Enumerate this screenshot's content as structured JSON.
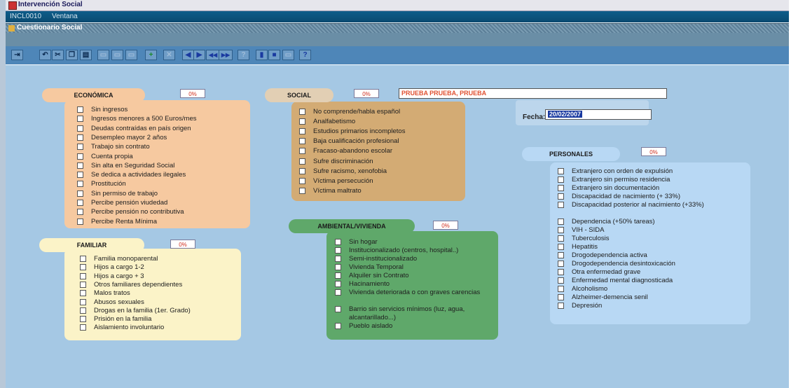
{
  "window": {
    "title": "Intervención Social",
    "menu": [
      "INCL0010",
      "Ventana"
    ],
    "form_title": "Cuestionario Social"
  },
  "toolbar": {
    "buttons": [
      {
        "icon": "exit-icon",
        "glyph": "⇥"
      },
      {
        "icon": "undo-icon",
        "glyph": "↶"
      },
      {
        "icon": "cut-icon",
        "glyph": "✂"
      },
      {
        "icon": "copy-icon",
        "glyph": "❐"
      },
      {
        "icon": "paste-icon",
        "glyph": "▤"
      },
      {
        "icon": "disabled-icon",
        "glyph": "▭"
      },
      {
        "icon": "disabled-icon",
        "glyph": "▭"
      },
      {
        "icon": "disabled-icon",
        "glyph": "▭"
      },
      {
        "icon": "insert-record-icon",
        "glyph": "+"
      },
      {
        "icon": "delete-record-icon",
        "glyph": "✕"
      },
      {
        "icon": "prev-record-icon",
        "glyph": "◀"
      },
      {
        "icon": "next-record-icon",
        "glyph": "▶"
      },
      {
        "icon": "prev-block-icon",
        "glyph": "◀◀"
      },
      {
        "icon": "next-block-icon",
        "glyph": "▶▶"
      },
      {
        "icon": "query-icon",
        "glyph": "?"
      },
      {
        "icon": "book-icon",
        "glyph": "▮"
      },
      {
        "icon": "save-icon",
        "glyph": "■"
      },
      {
        "icon": "print-icon",
        "glyph": "▭"
      },
      {
        "icon": "help-icon",
        "glyph": "?"
      }
    ]
  },
  "person_name": "PRUEBA PRUEBA, PRUEBA",
  "fecha": {
    "label": "Fecha:",
    "value": "20/02/2007"
  },
  "sections": {
    "economica": {
      "title": "ECONÓMICA",
      "percent": "0%",
      "items": [
        "Sin ingresos",
        "Ingresos menores a 500 Euros/mes",
        "Deudas contraídas en país origen",
        "Desempleo mayor 2 años",
        "Trabajo sin contrato",
        "Cuenta propia",
        "Sin alta en Seguridad Social",
        "Se dedica a actividades ilegales",
        "Prostitución",
        "Sin permiso de trabajo",
        "Percibe pensión viudedad",
        "Percibe pensión no contributiva",
        "Percibe Renta Mínima"
      ]
    },
    "social": {
      "title": "SOCIAL",
      "percent": "0%",
      "items": [
        "No comprende/habla español",
        "Analfabetismo",
        "Estudios primarios incompletos",
        "Baja cualificación profesional",
        "Fracaso-abandono escolar",
        "Sufre discriminación",
        "Sufre racismo, xenofobia",
        "Víctima persecución",
        "Víctima maltrato"
      ]
    },
    "familiar": {
      "title": "FAMILIAR",
      "percent": "0%",
      "items": [
        "Familia monoparental",
        "Hijos a cargo 1-2",
        "Hijos a cargo + 3",
        "Otros familiares dependientes",
        "Malos tratos",
        "Abusos sexuales",
        "Drogas en la familia (1er. Grado)",
        "Prisión en la familia",
        "Aislamiento involuntario"
      ]
    },
    "ambiental": {
      "title": "AMBIENTAL/VIVIENDA",
      "percent": "0%",
      "items": [
        "Sin hogar",
        "Institucionalizado (centros, hospital..)",
        "Semi-institucionalizado",
        "Vivienda Temporal",
        "Alquiler sin Contrato",
        "Hacinamiento",
        "Vivienda deteriorada o con graves carencias",
        "Barrio sin servicios mínimos (luz, agua, alcantarillado...)",
        "Pueblo aislado"
      ]
    },
    "personales": {
      "title": "PERSONALES",
      "percent": "0%",
      "items": [
        "Extranjero con orden de expulsión",
        "Extranjero sin permiso residencia",
        "Extranjero sin documentación",
        "Discapacidad de nacimiento (+ 33%)",
        "Discapacidad posterior al nacimiento (+33%)",
        "Dependencia (+50% tareas)",
        "VIH - SIDA",
        "Tuberculosis",
        "Hepatitis",
        "Drogodependencia activa",
        "Drogodependencia desintoxicación",
        "Otra enfermedad grave",
        "Enfermedad mental diagnosticada",
        "Alcoholismo",
        "Alzheimer-demencia senil",
        "Depresión"
      ]
    }
  },
  "colors": {
    "economica_panel": "#f6c9a0",
    "economica_tag": "#f6c9a0",
    "social_panel": "#d3ab74",
    "social_tag": "#e2cfb4",
    "familiar_panel": "#fbf3c8",
    "ambiental_panel": "#5fa86a",
    "ambiental_tag": "#5fa86a",
    "personales_panel": "#b8d8f4",
    "personales_tag": "#b8d8f4",
    "name_text": "#e05030",
    "fecha_field": "#1a3aa0"
  }
}
